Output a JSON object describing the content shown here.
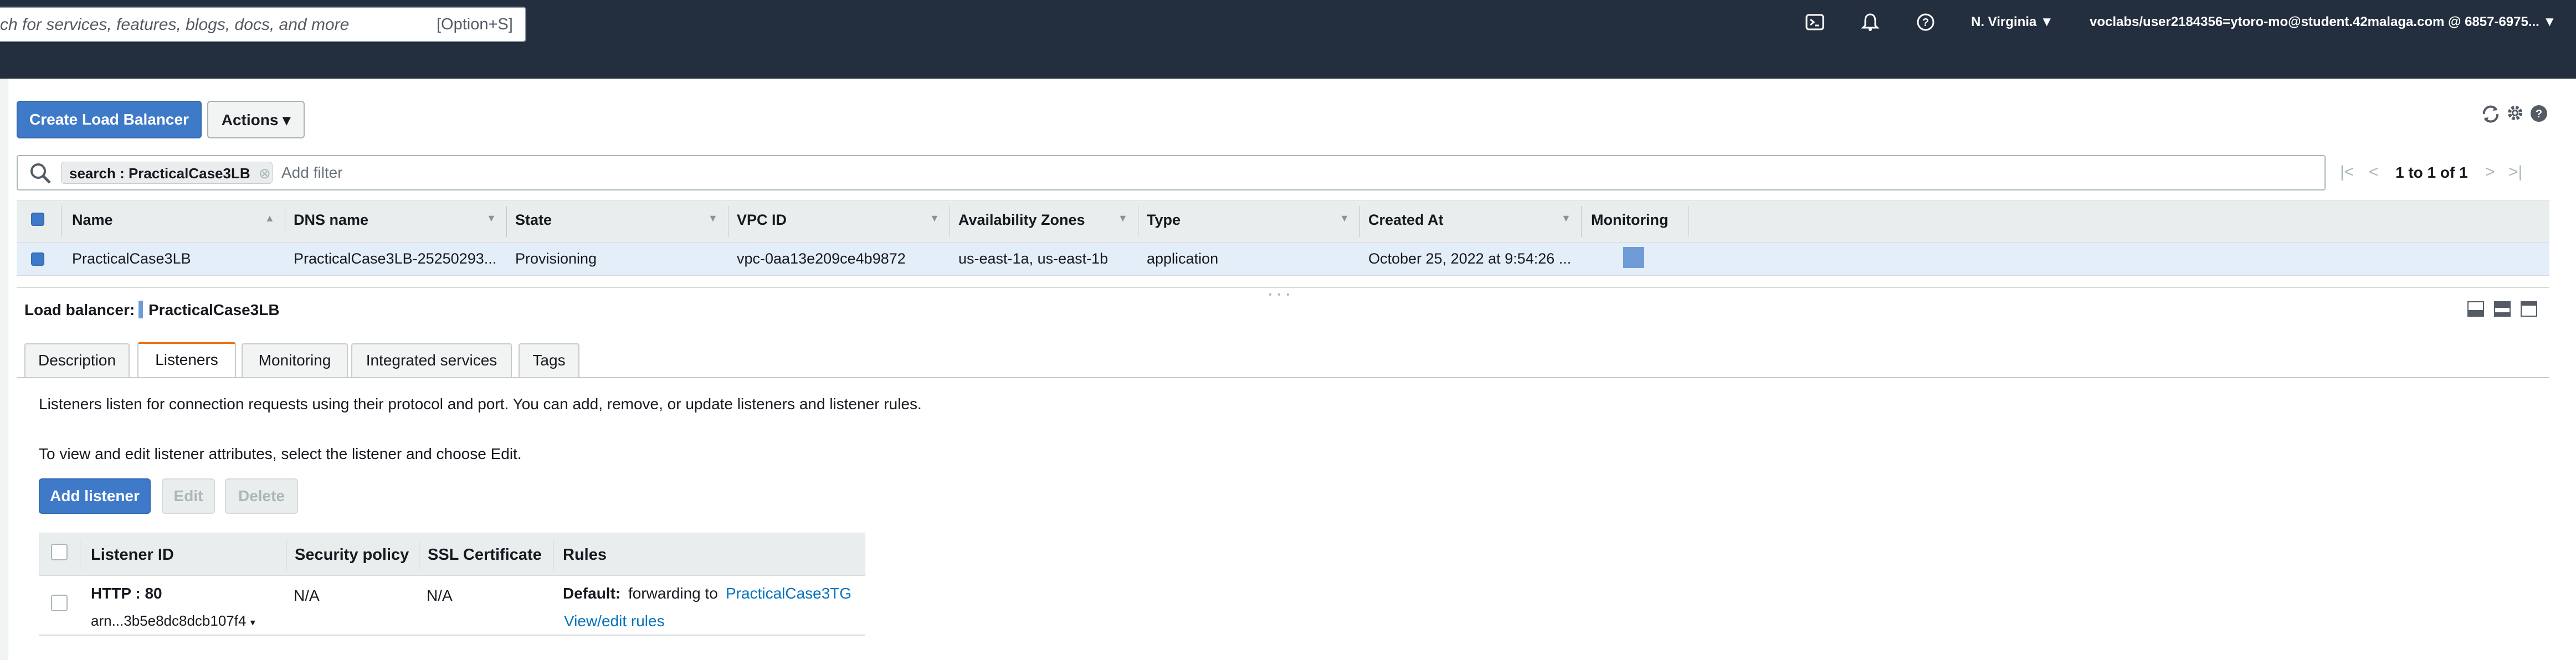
{
  "topnav": {
    "search_placeholder": "ch for services, features, blogs, docs, and more",
    "search_shortcut": "[Option+S]",
    "region": "N. Virginia ▼",
    "account": "voclabs/user2184356=ytoro-mo@student.42malaga.com @ 6857-6975... ▼",
    "icons": [
      "cloudshell-icon",
      "bell-icon",
      "help-icon"
    ]
  },
  "toolbar": {
    "create_label": "Create Load Balancer",
    "actions_label": "Actions ▾",
    "icons": [
      "refresh-icon",
      "settings-icon",
      "help-icon"
    ]
  },
  "filter": {
    "token": "search : PracticalCase3LB",
    "placeholder": "Add filter",
    "pagination": "1 to 1 of 1"
  },
  "table": {
    "columns": [
      "Name",
      "DNS name",
      "State",
      "VPC ID",
      "Availability Zones",
      "Type",
      "Created At",
      "Monitoring"
    ],
    "row": {
      "name": "PracticalCase3LB",
      "dns": "PracticalCase3LB-25250293...",
      "state": "Provisioning",
      "vpc": "vpc-0aa13e209ce4b9872",
      "zones": "us-east-1a, us-east-1b",
      "type": "application",
      "created": "October 25, 2022 at 9:54:26 ..."
    }
  },
  "detail": {
    "label": "Load balancer:",
    "name": "PracticalCase3LB",
    "tabs": [
      "Description",
      "Listeners",
      "Monitoring",
      "Integrated services",
      "Tags"
    ],
    "active_tab": "Listeners",
    "info1": "Listeners listen for connection requests using their protocol and port. You can add, remove, or update listeners and listener rules.",
    "info2": "To view and edit listener attributes, select the listener and choose Edit.",
    "buttons": {
      "add": "Add listener",
      "edit": "Edit",
      "delete": "Delete"
    }
  },
  "listeners": {
    "columns": [
      "Listener ID",
      "Security policy",
      "SSL Certificate",
      "Rules"
    ],
    "row": {
      "id": "HTTP : 80",
      "arn": "arn...3b5e8dc8dcb107f4",
      "policy": "N/A",
      "cert": "N/A",
      "default_label": "Default:",
      "forwarding": "forwarding to",
      "target": "PracticalCase3TG",
      "view_rules": "View/edit rules"
    }
  },
  "colors": {
    "nav_bg": "#232f3e",
    "primary": "#3f7ac9",
    "active_tab": "#ec7211",
    "link": "#0073bb",
    "selected_row": "#e4eef9"
  }
}
